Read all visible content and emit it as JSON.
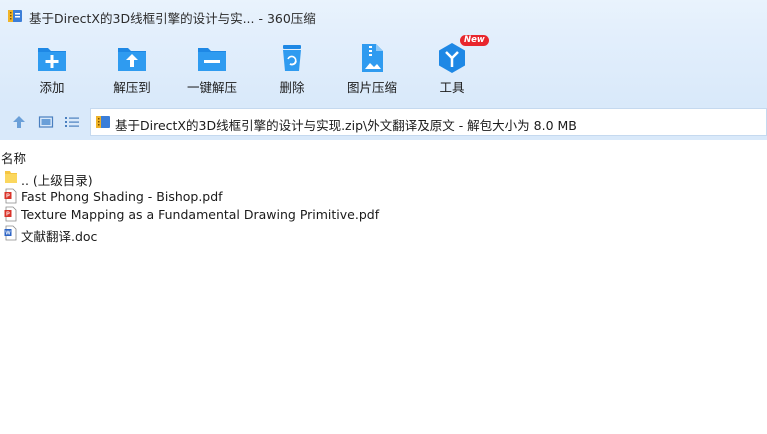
{
  "window": {
    "title": "基于DirectX的3D线框引擎的设计与实... - 360压缩",
    "icon": "archive-app-icon"
  },
  "toolbar": {
    "items": [
      {
        "label": "添加",
        "icon": "add-folder-icon"
      },
      {
        "label": "解压到",
        "icon": "extract-to-icon"
      },
      {
        "label": "一键解压",
        "icon": "one-click-extract-icon"
      },
      {
        "label": "删除",
        "icon": "delete-icon"
      },
      {
        "label": "图片压缩",
        "icon": "image-compress-icon"
      },
      {
        "label": "工具",
        "icon": "tools-icon",
        "badge": "New"
      }
    ]
  },
  "nav": {
    "up_icon": "up-arrow-icon",
    "thumb_view_icon": "thumbnail-view-icon",
    "list_view_icon": "list-view-icon"
  },
  "address": {
    "path": "基于DirectX的3D线框引擎的设计与实现.zip\\外文翻译及原文 - 解包大小为 8.0 MB",
    "icon": "zip-icon"
  },
  "columns": {
    "name": "名称"
  },
  "files": [
    {
      "name": ".. (上级目录)",
      "icon": "folder-icon"
    },
    {
      "name": "Fast Phong Shading - Bishop.pdf",
      "icon": "pdf-icon"
    },
    {
      "name": "Texture Mapping as a Fundamental Drawing Primitive.pdf",
      "icon": "pdf-icon"
    },
    {
      "name": "文献翻译.doc",
      "icon": "doc-icon"
    }
  ],
  "colors": {
    "titlebar": "#e9f3fd",
    "toolbar": "#dce9f9",
    "accent_blue": "#1e88e5",
    "badge_red": "#e8262d"
  }
}
